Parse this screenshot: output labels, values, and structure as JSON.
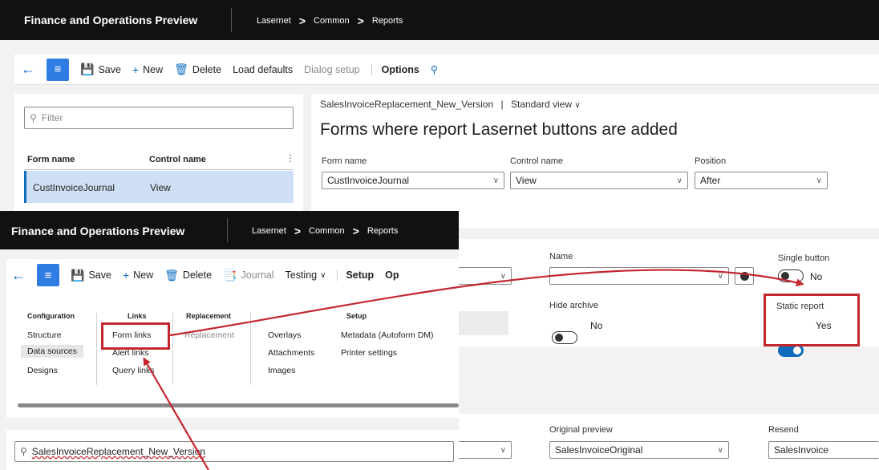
{
  "back_window": {
    "app_name": "Finance and Operations Preview",
    "breadcrumb": [
      "Lasernet",
      "Common",
      "Reports"
    ],
    "toolbar": {
      "save": "Save",
      "new": "New",
      "delete": "Delete",
      "load_defaults": "Load defaults",
      "dialog_setup": "Dialog setup",
      "options": "Options"
    },
    "filter_placeholder": "Filter",
    "grid": {
      "col_form": "Form name",
      "col_control": "Control name",
      "row_form": "CustInvoiceJournal",
      "row_control": "View"
    },
    "view_line": {
      "record": "SalesInvoiceReplacement_New_Version",
      "divider": "|",
      "view": "Standard view"
    },
    "heading": "Forms where report Lasernet buttons are added",
    "fields": {
      "form_name_label": "Form name",
      "form_name_value": "CustInvoiceJournal",
      "control_name_label": "Control name",
      "control_name_value": "View",
      "position_label": "Position",
      "position_value": "After"
    },
    "name_label": "Name",
    "single_button_label": "Single button",
    "single_button_value": "No",
    "hide_archive_label": "Hide archive",
    "hide_archive_value": "No",
    "static_report_label": "Static report",
    "static_report_value": "Yes",
    "original_preview_label": "Original preview",
    "original_preview_value": "SalesInvoiceOriginal",
    "resend_label": "Resend",
    "resend_value": "SalesInvoice"
  },
  "front_window": {
    "app_name": "Finance and Operations Preview",
    "breadcrumb": [
      "Lasernet",
      "Common",
      "Reports"
    ],
    "toolbar": {
      "save": "Save",
      "new": "New",
      "delete": "Delete",
      "journal": "Journal",
      "testing": "Testing",
      "setup": "Setup",
      "options_trunc": "Op"
    },
    "menu": {
      "configuration": {
        "header": "Configuration",
        "items": [
          "Structure",
          "Data sources",
          "Designs"
        ]
      },
      "links": {
        "header": "Links",
        "items": [
          "Form links",
          "Alert links",
          "Query links"
        ]
      },
      "replacement": {
        "header": "Replacement",
        "items": [
          "Replacement"
        ]
      },
      "setup_a": {
        "items": [
          "Overlays",
          "Attachments",
          "Images"
        ]
      },
      "setup_b": {
        "header": "Setup",
        "items": [
          "Metadata (Autoform DM)",
          "Printer settings"
        ]
      }
    },
    "search_value": "SalesInvoiceReplacement_New_Version"
  },
  "accent": "#0f6cbd",
  "highlight": "#c4262e"
}
